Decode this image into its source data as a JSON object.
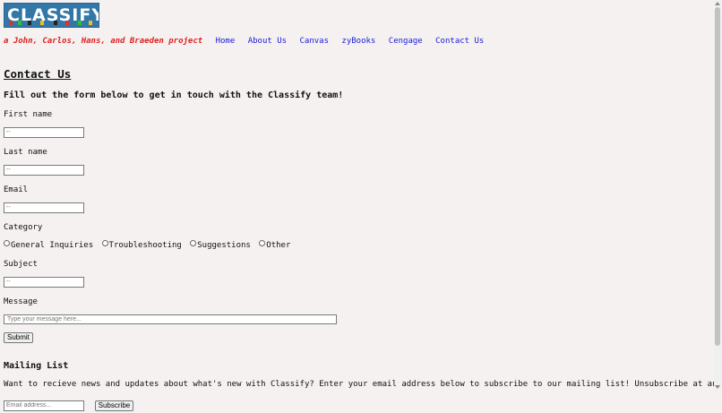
{
  "logo": {
    "text": "CLASSIFY"
  },
  "header": {
    "tagline": "a John, Carlos, Hans, and Braeden project",
    "nav": [
      "Home",
      "About Us",
      "Canvas",
      "zyBooks",
      "Cengage",
      "Contact Us"
    ]
  },
  "contact": {
    "heading": "Contact Us",
    "intro": "Fill out the form below to get in touch with the Classify team!",
    "first_name_label": "First name",
    "first_name_placeholder": "--",
    "last_name_label": "Last name",
    "last_name_placeholder": "--",
    "email_label": "Email",
    "email_placeholder": "--",
    "category_label": "Category",
    "categories": [
      "General Inquiries",
      "Troubleshooting",
      "Suggestions",
      "Other"
    ],
    "subject_label": "Subject",
    "subject_placeholder": "--",
    "message_label": "Message",
    "message_placeholder": "Type your message here...",
    "submit_label": "Submit"
  },
  "mailing": {
    "heading": "Mailing List",
    "text": "Want to recieve news and updates about what's new with Classify? Enter your email address below to subscribe to our mailing list! Unsubscribe at any time.",
    "email_placeholder": "Email address...",
    "subscribe_label": "Subscribe"
  },
  "colors": {
    "logo_bg": "#3377a8",
    "tagline": "#e02020",
    "nav_link": "#1a1ad8",
    "page_bg": "#f4f1f0"
  }
}
